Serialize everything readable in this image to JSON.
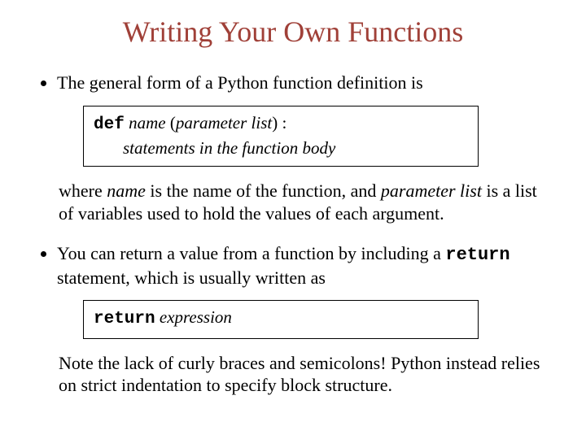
{
  "title": "Writing Your Own Functions",
  "bullet1_text": "The general form of a Python function definition is",
  "box1": {
    "kw_def": "def",
    "name": "name",
    "open": " (",
    "paramlist": "parameter list",
    "close_colon": ") :",
    "body": "statements in the function body"
  },
  "after1": {
    "pre": "where ",
    "name": "name",
    "mid1": " is the name of the function, and ",
    "paramlist": "parameter list",
    "mid2": " is a list of variables used to hold the values of each argument."
  },
  "bullet2": {
    "pre": "You can return a value from a function by including a ",
    "kw_return": "return",
    "post": " statement, which is usually written as"
  },
  "box2": {
    "kw_return": "return",
    "expr": "expression"
  },
  "after2": "Note the lack of curly braces and semicolons!  Python instead relies on strict indentation to specify block structure."
}
